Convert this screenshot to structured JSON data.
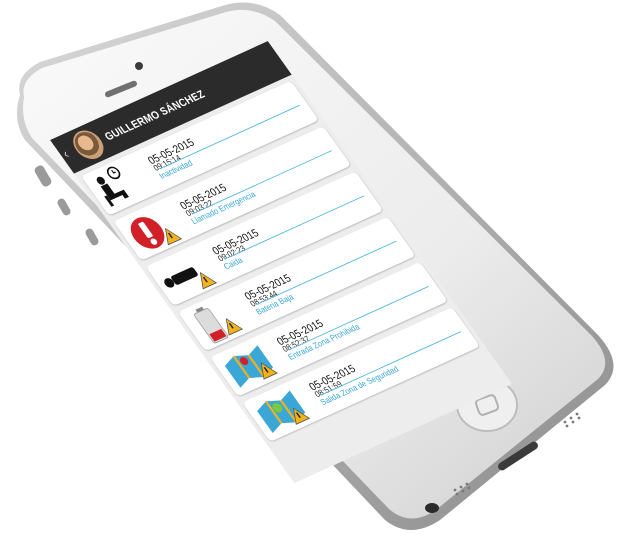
{
  "header": {
    "name": "GUILLERMO SÁNCHEZ",
    "back_glyph": "‹"
  },
  "alerts": [
    {
      "date": "05-05-2015",
      "time": "09:15:14",
      "event": "Inactividad",
      "icon": "inactivity-icon"
    },
    {
      "date": "05-05-2015",
      "time": "09:03:22",
      "event": "Llamado Emergencia",
      "icon": "emergency-call-icon"
    },
    {
      "date": "05-05-2015",
      "time": "09:02:23",
      "event": "Caida",
      "icon": "fall-icon"
    },
    {
      "date": "05-05-2015",
      "time": "08:53:44",
      "event": "Bateria Baja",
      "icon": "low-battery-icon"
    },
    {
      "date": "05-05-2015",
      "time": "08:52:37",
      "event": "Entrada Zona Prohibida",
      "icon": "forbidden-zone-icon"
    },
    {
      "date": "05-05-2015",
      "time": "08:51:59",
      "event": "Salida Zona de Seguridad",
      "icon": "safe-zone-exit-icon"
    }
  ],
  "colors": {
    "appbar": "#2b2b2b",
    "accent": "#3aa7d6",
    "warning": "#f2b21c"
  }
}
